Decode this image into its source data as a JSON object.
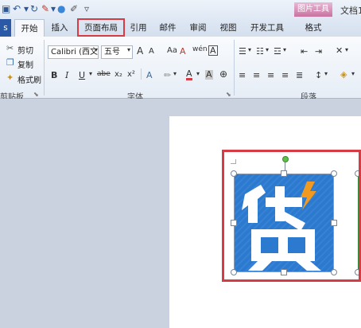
{
  "quick_access": {
    "icons": [
      "save-icon",
      "undo-icon",
      "redo-icon",
      "format-painter-icon",
      "draw-icon",
      "customize-icon"
    ]
  },
  "context_tab": {
    "label": "图片工具"
  },
  "document_title": "文档1",
  "tabs": [
    {
      "label": "开始",
      "active": true
    },
    {
      "label": "插入",
      "active": false
    },
    {
      "label": "页面布局",
      "active": false
    },
    {
      "label": "引用",
      "active": false
    },
    {
      "label": "邮件",
      "active": false
    },
    {
      "label": "审阅",
      "active": false
    },
    {
      "label": "视图",
      "active": false
    },
    {
      "label": "开发工具",
      "active": false
    },
    {
      "label": "格式",
      "active": false
    }
  ],
  "clipboard": {
    "cut_label": "剪切",
    "copy_label": "复制",
    "painter_label": "格式刷",
    "group_label": "剪贴板"
  },
  "font": {
    "font_name": "Calibri (西文)",
    "font_size": "五号",
    "group_label": "字体",
    "bold": "B",
    "italic": "I",
    "underline": "U",
    "strikethrough": "abe",
    "subscript": "x₂",
    "superscript": "x²",
    "grow": "A",
    "shrink": "A",
    "change_case": "Aa",
    "clear_format": "A",
    "pinyin": "wén",
    "char_border": "A",
    "highlight": "A",
    "font_color": "A",
    "char_shading": "A",
    "enclose": "字"
  },
  "paragraph": {
    "group_label": "段落"
  },
  "image": {
    "glyph": "贷",
    "bolt": "⚡",
    "bg_color": "#2b7ad0"
  },
  "highlight_color": "#d63c44"
}
